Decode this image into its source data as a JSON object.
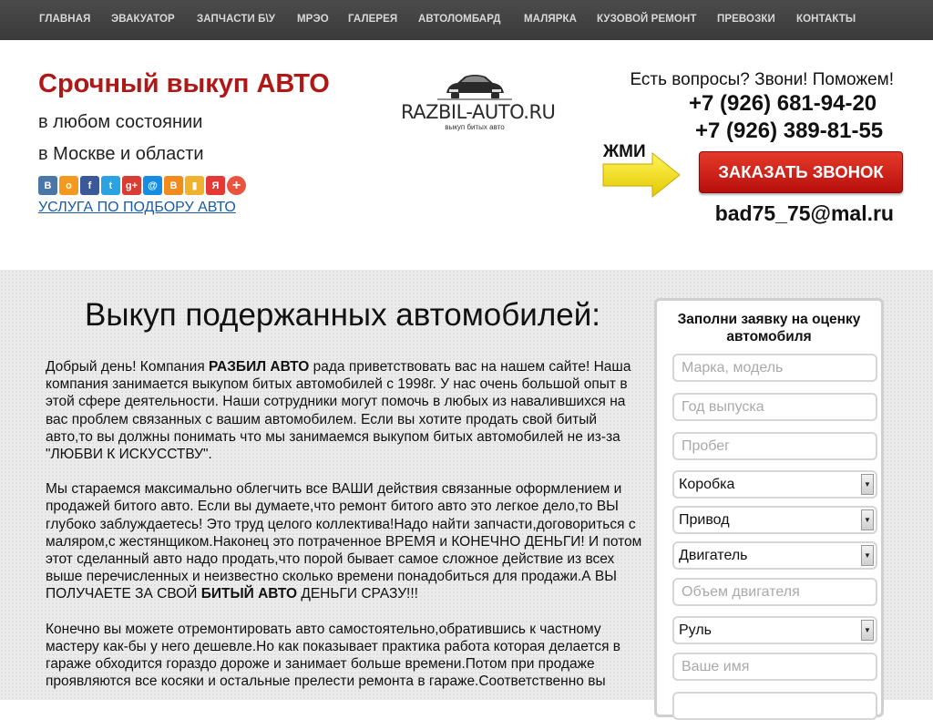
{
  "nav": [
    {
      "label": "ГЛАВНАЯ"
    },
    {
      "label": "ЭВАКУАТОР"
    },
    {
      "label": "ЗАПЧАСТИ Б\\У"
    },
    {
      "label": "МРЭО"
    },
    {
      "label": "ГАЛЕРЕЯ"
    },
    {
      "label": "АВТОЛОМБАРД"
    },
    {
      "label": "МАЛЯРКА"
    },
    {
      "label": "КУЗОВОЙ РЕМОНТ"
    },
    {
      "label": "ПРЕВОЗКИ"
    },
    {
      "label": "КОНТАКТЫ"
    }
  ],
  "header": {
    "title": "Срочный выкуп АВТО",
    "line1": "в любом состоянии",
    "line2": "в Москве и области",
    "share_icons": [
      {
        "name": "vk-icon",
        "glyph": "В",
        "color": "#4a76a8"
      },
      {
        "name": "odnoklassniki-icon",
        "glyph": "о",
        "color": "#f39a1e"
      },
      {
        "name": "facebook-icon",
        "glyph": "f",
        "color": "#3b5998"
      },
      {
        "name": "twitter-icon",
        "glyph": "t",
        "color": "#2ba3e1"
      },
      {
        "name": "google-plus-icon",
        "glyph": "g+",
        "color": "#d73d32"
      },
      {
        "name": "mailru-icon",
        "glyph": "@",
        "color": "#168de2"
      },
      {
        "name": "blogger-icon",
        "glyph": "B",
        "color": "#f28b1d"
      },
      {
        "name": "bookmark-icon",
        "glyph": "▮",
        "color": "#f0b22e"
      },
      {
        "name": "yandex-icon",
        "glyph": "Я",
        "color": "#e53935"
      },
      {
        "name": "more-icon",
        "glyph": "+",
        "color": "#e8543e"
      }
    ],
    "service_link": "УСЛУГА ПО ПОДБОРУ АВТО",
    "logo_text": "RAZBIL-AUTO.RU",
    "logo_tagline": "выкуп битых авто",
    "question": "Есть вопросы? Звони! Поможем!",
    "phone1": "+7 (926) 681-94-20",
    "phone2": "+7 (926) 389-81-55",
    "press_label": "ЖМИ",
    "call_button": "ЗАКАЗАТЬ ЗВОНОК",
    "email": "bad75_75@mal.ru",
    "title_color": "#b01818",
    "button_color": "#cc1e16"
  },
  "main": {
    "heading": "Выкуп подержанных автомобилей:",
    "p1_a": "Добрый день! Компания ",
    "p1_b": "РАЗБИЛ АВТО",
    "p1_c": " рада приветствовать вас на нашем сайте! Наша компания занимается выкупом битых автомобилей с 1998г. У нас очень большой опыт в этой сфере деятельности. Наши сотрудники могут помочь в любых из навалившихся на вас проблем связанных с вашим автомобилем. Если вы хотите продать свой битый авто,то вы должны понимать что мы занимаемся выкупом битых автомобилей не из-за \"ЛЮБВИ К ИСКУССТВУ\".",
    "p2_a": "Мы стараемся максимально облегчить все ВАШИ действия связанные оформлением и продажей битого авто. Если вы думаете,что ремонт битого авто это легкое дело,то ВЫ глубоко заблуждаетесь! Это труд целого коллектива!Надо найти запчасти,договориться с маляром,с жестянщиком.Наконец это потраченное ВРЕМЯ и КОНЕЧНО ДЕНЬГИ! И потом этот сделанный авто надо продать,что порой бывает самое сложное действие из всех выше перечисленных и неизвестно сколько времени понадобиться для продажи.А ВЫ ПОЛУЧАЕТЕ ЗА СВОЙ ",
    "p2_b": "БИТЫЙ АВТО",
    "p2_c": " ДЕНЬГИ СРАЗУ!!!",
    "p3": "Конечно вы можете отремонтировать авто самостоятельно,обратившись к частному мастеру как-бы у него дешевле.Но как показывает практика работа которая делается в гараже обходится гораздо дороже и занимает больше времени.Потом при продаже проявляются все косяки и остальные прелести ремонта в гараже.Соответственно вы"
  },
  "form": {
    "title": "Заполни заявку на оценку автомобиля",
    "make_placeholder": "Марка, модель",
    "year_placeholder": "Год выпуска",
    "mileage_placeholder": "Пробег",
    "gearbox": "Коробка",
    "drive": "Привод",
    "engine": "Двигатель",
    "volume_placeholder": "Объем двигателя",
    "steering": "Руль",
    "name_placeholder": "Ваше имя"
  }
}
